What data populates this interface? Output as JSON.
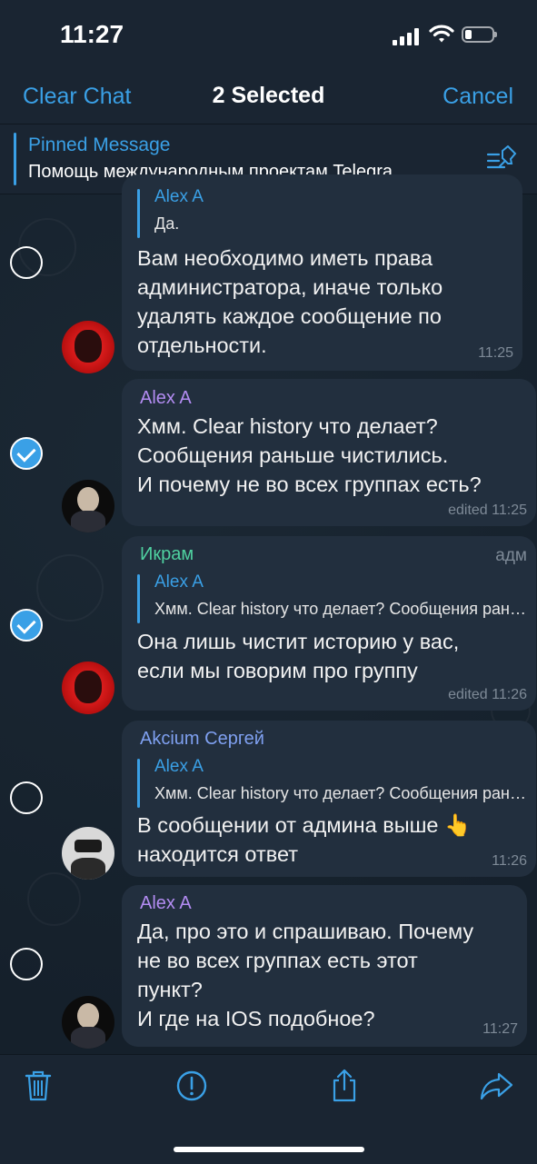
{
  "status": {
    "time": "11:27"
  },
  "nav": {
    "left": "Clear Chat",
    "title": "2 Selected",
    "right": "Cancel"
  },
  "pinned": {
    "title": "Pinned Message",
    "text": "Помощь международным проектам Telegra…",
    "icon": "pin-list-icon"
  },
  "messages": [
    {
      "reply_name": "Alex A",
      "reply_text": "Да.",
      "text": "Вам необходимо иметь права\nадминистратора, иначе только\nудалять каждое сообщение по\nотдельности.",
      "time": "11:25",
      "selected": false
    },
    {
      "sender": "Alex A",
      "sender_color": "#b38cf2",
      "text": "Хмм. Clear history что делает?\nСообщения раньше чистились.\nИ почему не во всех группах есть?",
      "time": "edited 11:25",
      "selected": true
    },
    {
      "sender": "Икрам",
      "sender_color": "#4fd1a0",
      "admin_label": "адм",
      "reply_name": "Alex A",
      "reply_text": "Хмм. Clear history что делает? Сообщения раньше чистились.",
      "text": "Она лишь чистит историю у вас,\nесли мы говорим про группу",
      "time": "edited 11:26",
      "selected": true
    },
    {
      "sender": "Akcium Сергей",
      "sender_color": "#7fa0f0",
      "reply_name": "Alex A",
      "reply_text": "Хмм. Clear history что делает? Сообщения раньше чистились.",
      "text": "В сообщении от админа выше 👆\nнаходится ответ",
      "time": "11:26",
      "selected": false
    },
    {
      "sender": "Alex A",
      "sender_color": "#b38cf2",
      "text": "Да, про это и спрашиваю. Почему\nне во всех группах есть этот\nпункт?\nИ где на IOS подобное?",
      "time": "11:27",
      "selected": false
    }
  ],
  "toolbar": [
    "trash-icon",
    "report-icon",
    "share-icon",
    "forward-icon"
  ],
  "colors": {
    "accent": "#3aa0e6",
    "bubble": "#222f3e",
    "background": "#17222d"
  }
}
